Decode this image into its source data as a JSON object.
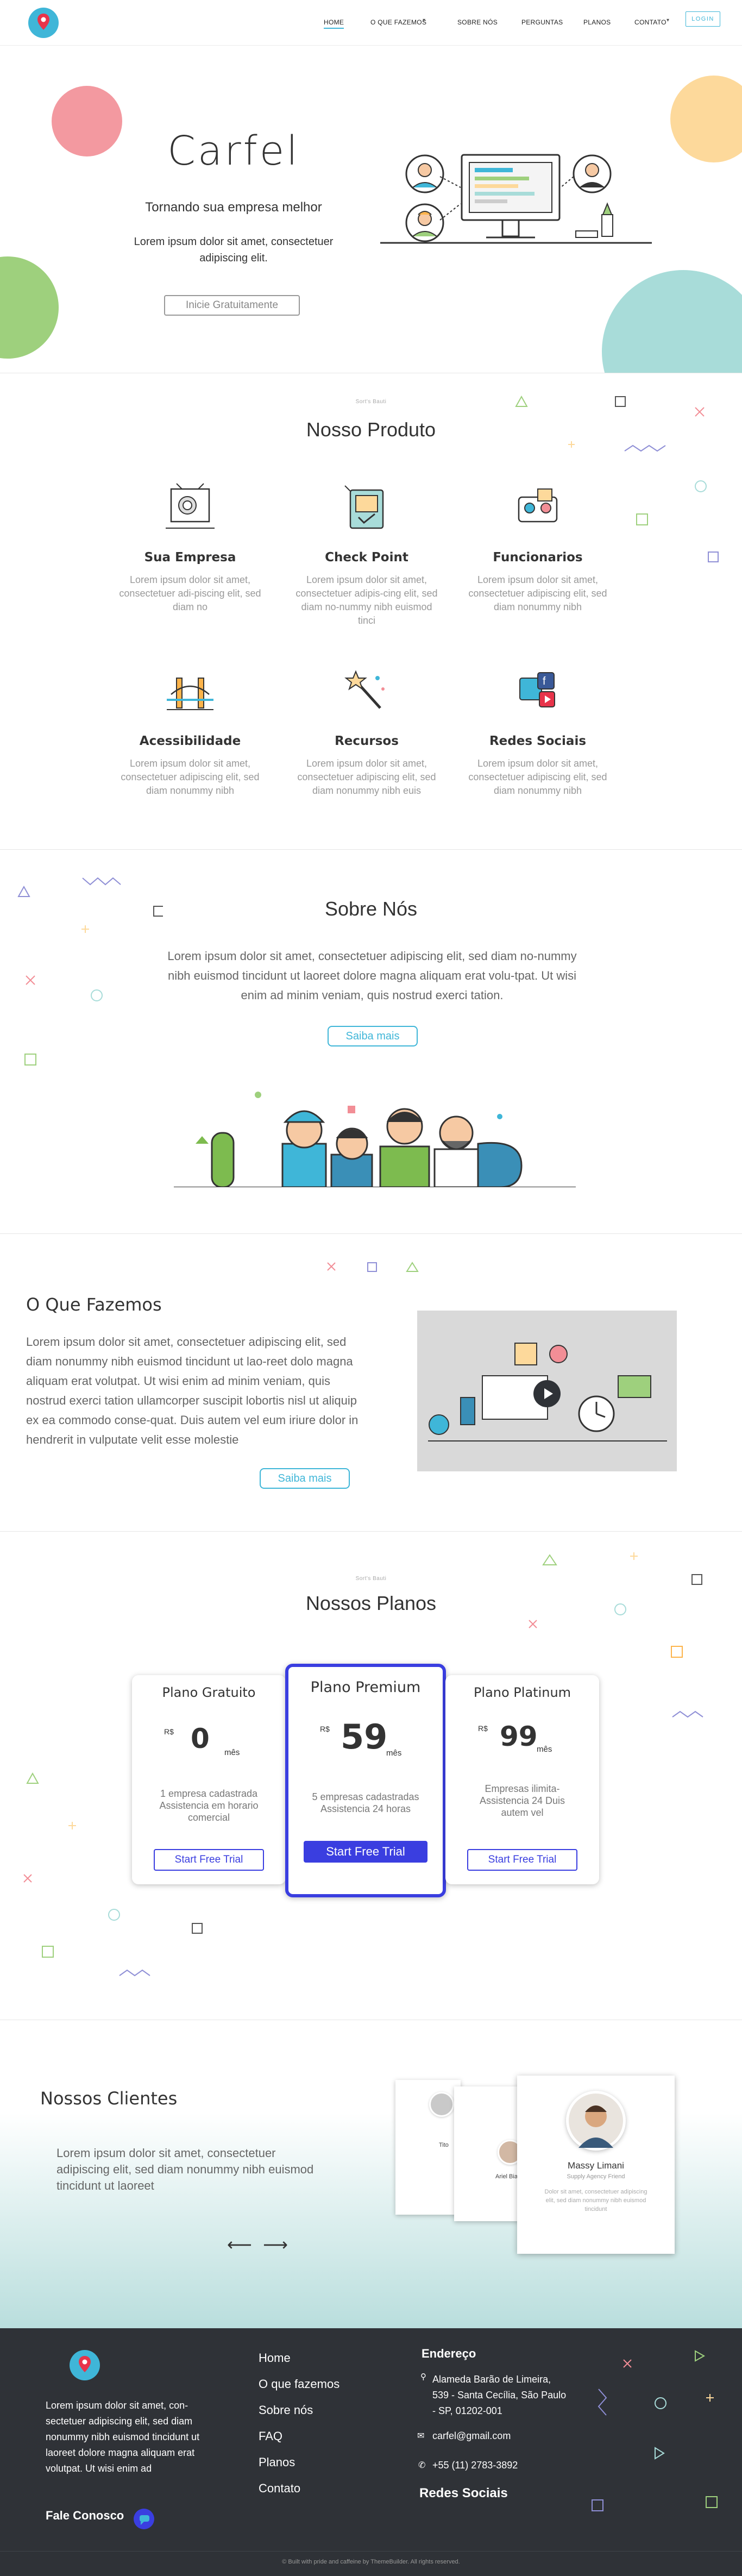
{
  "nav": {
    "items": [
      {
        "label": "HOME"
      },
      {
        "label": "O QUE FAZEMOS"
      },
      {
        "label": "SOBRE NÓS"
      },
      {
        "label": "PERGUNTAS"
      },
      {
        "label": "PLANOS"
      },
      {
        "label": "CONTATO"
      }
    ],
    "login": "LOGIN"
  },
  "hero": {
    "title": "Carfel",
    "subtitle": "Tornando sua empresa melhor",
    "description": "Lorem ipsum dolor sit amet, consectetuer adipiscing elit.",
    "cta": "Inicie Gratuitamente"
  },
  "produto": {
    "kicker": "Sort's Bauti",
    "title": "Nosso Produto",
    "features": [
      {
        "title": "Sua Empresa",
        "text": "Lorem ipsum dolor sit amet, consectetuer adi-piscing elit, sed diam no"
      },
      {
        "title": "Check Point",
        "text": "Lorem ipsum dolor sit amet, consectetuer adipis-cing elit, sed diam no-nummy nibh euismod tinci"
      },
      {
        "title": "Funcionarios",
        "text": "Lorem ipsum dolor sit amet, consectetuer adipiscing elit, sed diam nonummy nibh"
      },
      {
        "title": "Acessibilidade",
        "text": "Lorem ipsum dolor sit amet, consectetuer adipiscing elit, sed diam nonummy nibh"
      },
      {
        "title": "Recursos",
        "text": "Lorem ipsum dolor sit amet, consectetuer adipiscing elit, sed diam nonummy nibh euis"
      },
      {
        "title": "Redes Sociais",
        "text": "Lorem ipsum dolor sit amet, consectetuer adipiscing elit, sed diam nonummy nibh"
      }
    ]
  },
  "sobre": {
    "title": "Sobre Nós",
    "text": "Lorem ipsum dolor sit amet, consectetuer adipiscing elit, sed diam no-nummy nibh euismod tincidunt ut laoreet dolore magna aliquam erat volu-tpat. Ut wisi enim ad minim veniam, quis nostrud exerci tation.",
    "button": "Saiba mais"
  },
  "fazemos": {
    "title": "O Que Fazemos",
    "text": "Lorem ipsum dolor sit amet, consectetuer adipiscing elit, sed diam nonummy nibh euismod tincidunt ut lao-reet dolo magna aliquam erat volutpat. Ut wisi enim ad minim veniam, quis nostrud exerci tation ullamcorper suscipit lobortis nisl ut aliquip ex ea commodo conse-quat. Duis autem vel eum iriure dolor in hendrerit in vulputate velit esse molestie",
    "button": "Saiba mais"
  },
  "planos": {
    "kicker": "Sort's Bauti",
    "title": "Nossos Planos",
    "plans": [
      {
        "name": "Plano Gratuito",
        "currency": "R$",
        "price": "0",
        "period": "mês",
        "features": "1 empresa cadastrada Assistencia em horario comercial",
        "button": "Start Free Trial"
      },
      {
        "name": "Plano Premium",
        "currency": "R$",
        "price": "59",
        "period": "mês",
        "features": "5 empresas cadastradas Assistencia 24 horas",
        "button": "Start Free Trial"
      },
      {
        "name": "Plano Platinum",
        "currency": "R$",
        "price": "99",
        "period": "mês",
        "features": "Empresas ilimita-Assistencia 24 Duis autem vel",
        "button": "Start Free Trial"
      }
    ],
    "accent": "#3a3ee0"
  },
  "clientes": {
    "title": "Nossos Clientes",
    "text": "Lorem ipsum dolor sit amet, consectetuer adipiscing elit, sed diam nonummy nibh euismod tincidunt ut laoreet",
    "card_name": "Massy Limani",
    "card_role": "Supply Agency Friend",
    "card_text": "Dolor sit amet, consectetuer adipiscing elit, sed diam nonummy nibh euismod tincidunt",
    "back_card_name_1": "Tito",
    "back_card_name_2": "Ariel Bia"
  },
  "footer": {
    "about": "Lorem ipsum dolor sit amet, con-sectetuer adipiscing elit, sed diam nonummy nibh euismod tincidunt ut laoreet dolore magna aliquam erat volutpat. Ut wisi enim ad",
    "contact_link": "Fale Conosco",
    "links": [
      "Home",
      "O que fazemos",
      "Sobre nós",
      "FAQ",
      "Planos",
      "Contato"
    ],
    "address_title": "Endereço",
    "address": "Alameda Barão de Limeira, 539 - Santa Cecília, São Paulo - SP, 01202-001",
    "email": "carfel@gmail.com",
    "phone": "+55 (11) 2783-3892",
    "social_title": "Redes Sociais",
    "copyright": "© Built with pride and caffeine by ThemeBuilder. All rights reserved."
  },
  "colors": {
    "primary": "#3fb6d8",
    "footer_bg": "#2f3237",
    "premium": "#3a3ee0"
  }
}
